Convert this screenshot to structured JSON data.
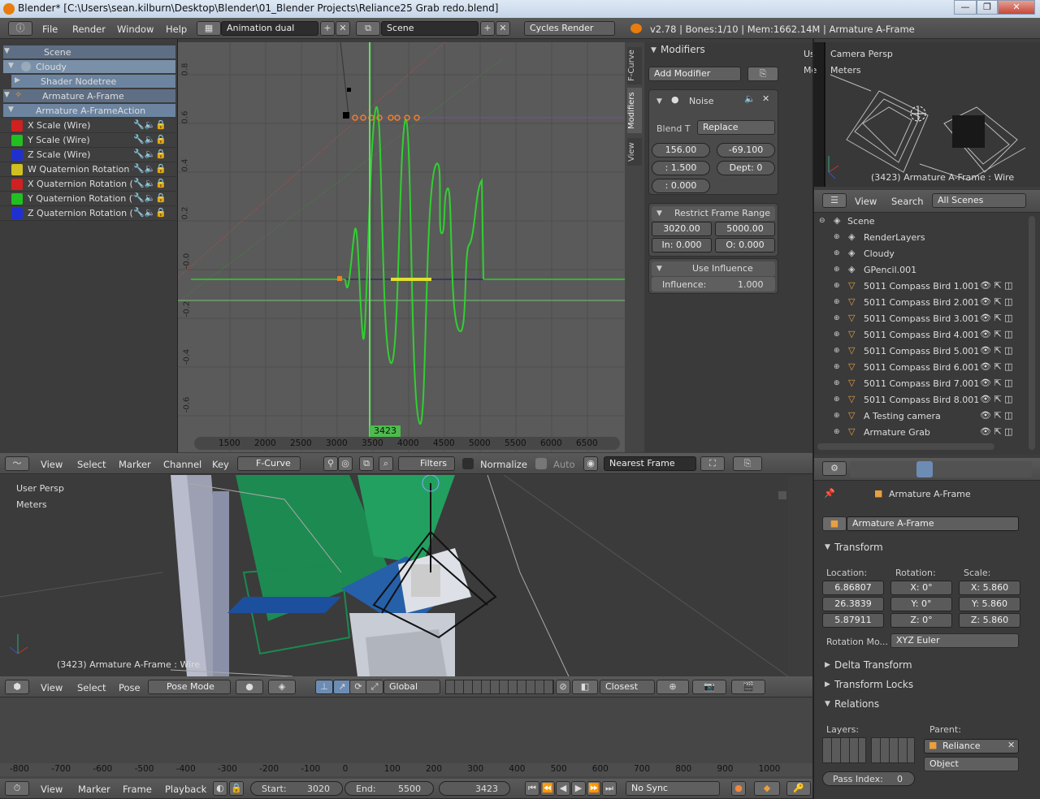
{
  "window": {
    "title": "Blender* [C:\\Users\\sean.kilburn\\Desktop\\Blender\\01_Blender Projects\\Reliance25 Grab redo.blend]",
    "min": "—",
    "max": "❐",
    "close": "✕"
  },
  "topbar": {
    "menus": [
      "File",
      "Render",
      "Window",
      "Help"
    ],
    "layout": "Animation dual",
    "scene": "Scene",
    "engine": "Cycles Render",
    "stats": "v2.78 | Bones:1/10  | Mem:1662.14M | Armature A-Frame"
  },
  "channels": {
    "rows": [
      {
        "label": "Scene"
      },
      {
        "label": "Cloudy"
      },
      {
        "label": "Shader Nodetree"
      },
      {
        "label": "Armature A-Frame"
      },
      {
        "label": "Armature A-FrameAction"
      },
      {
        "label": "X Scale (Wire)",
        "color": "#d02020"
      },
      {
        "label": "Y Scale (Wire)",
        "color": "#20c020"
      },
      {
        "label": "Z Scale (Wire)",
        "color": "#2030d0"
      },
      {
        "label": "W Quaternion Rotation (Wi",
        "color": "#d0c020"
      },
      {
        "label": "X Quaternion Rotation (Wi",
        "color": "#d02020"
      },
      {
        "label": "Y Quaternion Rotation (Wi",
        "color": "#20c020"
      },
      {
        "label": "Z Quaternion Rotation (Wi",
        "color": "#2030d0"
      }
    ]
  },
  "graph": {
    "y_ticks": [
      "0.8",
      "0.6",
      "0.4",
      "0.2",
      "-0.0",
      "-0.2",
      "-0.4",
      "-0.6"
    ],
    "x_ticks": [
      "1500",
      "2000",
      "2500",
      "3000",
      "3500",
      "4000",
      "4500",
      "5000",
      "5500",
      "6000",
      "6500"
    ],
    "current_frame": "3423",
    "side_tabs": [
      "F-Curve",
      "Modifiers",
      "View"
    ]
  },
  "modifiers": {
    "title": "Modifiers",
    "add": "Add Modifier",
    "noise": "Noise",
    "blend_label": "Blend T",
    "blend": "Replace",
    "scale": "156.00",
    "phase": "-69.100",
    "strength": ": 1.500",
    "depth": "Dept:  0",
    "offset": ": 0.000",
    "restrict": "Restrict Frame Range",
    "start": "3020.00",
    "end": "5000.00",
    "in": "In: 0.000",
    "out": "O: 0.000",
    "use_influence": "Use Influence",
    "influence_label": "Influence:",
    "influence": "1.000"
  },
  "graph_header": {
    "items": [
      "View",
      "Select",
      "Marker",
      "Channel",
      "Key"
    ],
    "mode": "F-Curve",
    "filters": "Filters",
    "normalize": "Normalize",
    "auto": "Auto",
    "snap": "Nearest Frame"
  },
  "cam_view": {
    "label": "Camera Persp",
    "unit": "Meters",
    "us": "Us",
    "me": "Me",
    "caption": "(3423) Armature A-Frame : Wire"
  },
  "viewport": {
    "label": "User Persp",
    "unit": "Meters",
    "caption": "(3423) Armature A-Frame : Wire"
  },
  "viewport_header": {
    "items": [
      "View",
      "Select",
      "Pose"
    ],
    "mode": "Pose Mode",
    "orient": "Global",
    "snap": "Closest"
  },
  "outliner": {
    "view": "View",
    "search": "Search",
    "filter": "All Scenes",
    "rows": [
      {
        "label": "Scene",
        "indent": 0
      },
      {
        "label": "RenderLayers",
        "indent": 1
      },
      {
        "label": "Cloudy",
        "indent": 1
      },
      {
        "label": "GPencil.001",
        "indent": 1
      },
      {
        "label": "5011 Compass Bird 1.001",
        "indent": 1
      },
      {
        "label": "5011 Compass Bird 2.001",
        "indent": 1
      },
      {
        "label": "5011 Compass Bird 3.001",
        "indent": 1
      },
      {
        "label": "5011 Compass Bird 4.001",
        "indent": 1
      },
      {
        "label": "5011 Compass Bird 5.001",
        "indent": 1
      },
      {
        "label": "5011 Compass Bird 6.001",
        "indent": 1
      },
      {
        "label": "5011 Compass Bird 7.001",
        "indent": 1
      },
      {
        "label": "5011 Compass Bird 8.001",
        "indent": 1
      },
      {
        "label": "A Testing camera",
        "indent": 1
      },
      {
        "label": "Armature Grab",
        "indent": 1
      }
    ]
  },
  "properties": {
    "breadcrumb": "Armature A-Frame",
    "name": "Armature A-Frame",
    "transform": "Transform",
    "location_label": "Location:",
    "rotation_label": "Rotation:",
    "scale_label": "Scale:",
    "loc": [
      "6.86807",
      "26.3839",
      "5.87911"
    ],
    "rot": [
      "X:        0°",
      "Y:        0°",
      "Z:        0°"
    ],
    "scale": [
      "X: 5.860",
      "Y: 5.860",
      "Z: 5.860"
    ],
    "rotmode_label": "Rotation Mo...",
    "rotmode": "XYZ Euler",
    "delta": "Delta Transform",
    "locks": "Transform Locks",
    "relations": "Relations",
    "layers_label": "Layers:",
    "parent_label": "Parent:",
    "parent": "Reliance",
    "parent_type": "Object",
    "pass_label": "Pass Index:",
    "pass": "0"
  },
  "timeline": {
    "ruler": [
      "-800",
      "-700",
      "-600",
      "-500",
      "-400",
      "-300",
      "-200",
      "-100",
      "0",
      "100",
      "200",
      "300",
      "400",
      "500",
      "600",
      "700",
      "800",
      "900",
      "1000"
    ],
    "items": [
      "View",
      "Marker",
      "Frame",
      "Playback"
    ],
    "start_label": "Start:",
    "start": "3020",
    "end_label": "End:",
    "end": "5500",
    "frame": "3423",
    "sync": "No Sync"
  }
}
